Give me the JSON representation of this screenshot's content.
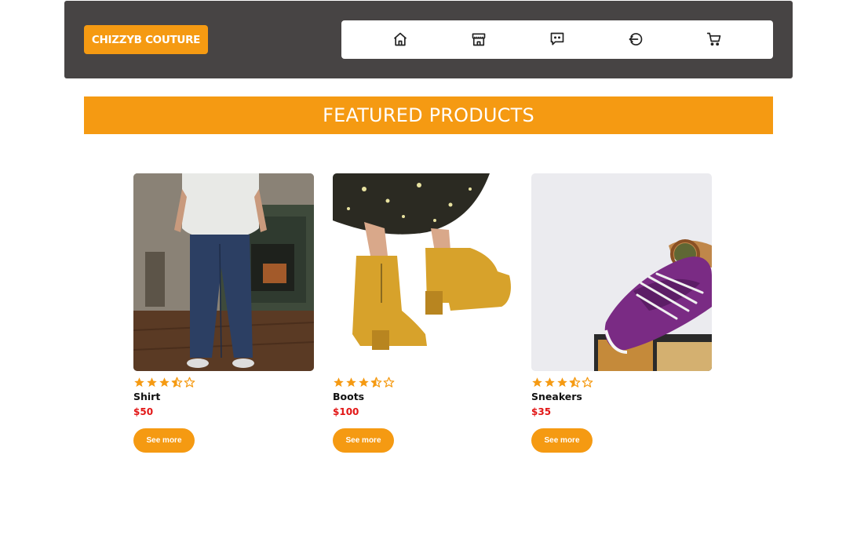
{
  "header": {
    "logo_text": "CHIZZYB COUTURE",
    "nav": [
      {
        "name": "home",
        "icon": "home-icon"
      },
      {
        "name": "store",
        "icon": "store-icon"
      },
      {
        "name": "chat",
        "icon": "chat-icon"
      },
      {
        "name": "logout",
        "icon": "logout-icon"
      },
      {
        "name": "cart",
        "icon": "cart-icon"
      }
    ]
  },
  "banner": {
    "title": "FEATURED PRODUCTS"
  },
  "products": [
    {
      "name": "Shirt",
      "price": "$50",
      "rating": 3.5,
      "max_rating": 5,
      "button_label": "See more",
      "image": "person-in-white-shirt-and-jeans"
    },
    {
      "name": "Boots",
      "price": "$100",
      "rating": 3.5,
      "max_rating": 5,
      "button_label": "See more",
      "image": "yellow-ankle-boots"
    },
    {
      "name": "Sneakers",
      "price": "$35",
      "rating": 3.5,
      "max_rating": 5,
      "button_label": "See more",
      "image": "purple-sneakers-and-sunglasses"
    }
  ],
  "colors": {
    "accent": "#f59a12",
    "header_bg": "#474444",
    "price": "#e21616"
  }
}
